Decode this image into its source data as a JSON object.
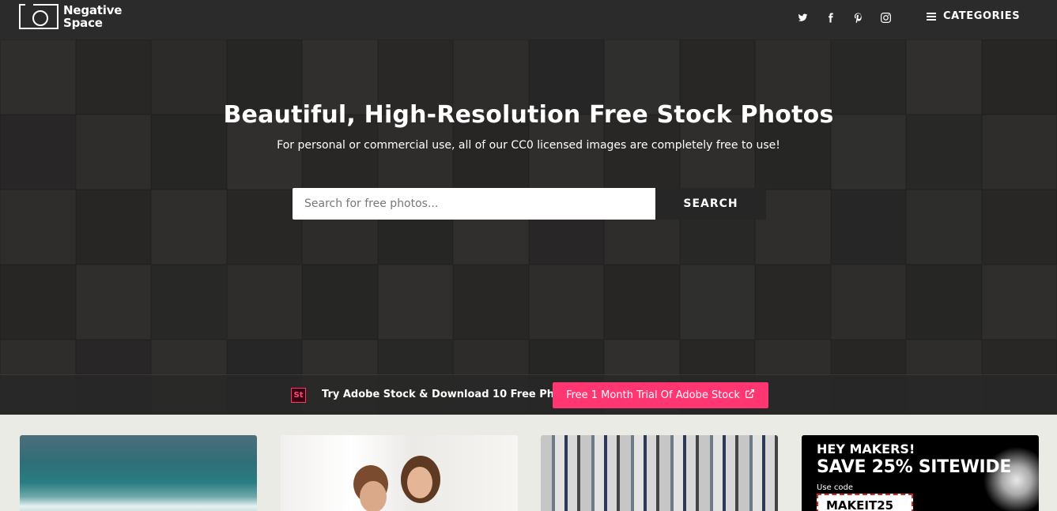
{
  "header": {
    "logo_line1": "Negative",
    "logo_line2": "Space",
    "social": [
      "twitter-icon",
      "facebook-icon",
      "pinterest-icon",
      "instagram-icon"
    ],
    "categories_label": "CATEGORIES"
  },
  "hero": {
    "title": "Beautiful, High-Resolution Free Stock Photos",
    "subtitle": "For personal or commercial use, all of our CC0 licensed images are completely free to use!",
    "search_placeholder": "Search for free photos...",
    "search_button": "SEARCH"
  },
  "promo": {
    "badge": "St",
    "text": "Try Adobe Stock & Download 10 Free Photos",
    "button": "Free 1 Month Trial Of Adobe Stock",
    "accent": "#ff3672"
  },
  "ad": {
    "line1": "HEY MAKERS!",
    "line2": "SAVE 25% SITEWIDE",
    "line3": "Use code",
    "code": "MAKEIT25"
  },
  "colors": {
    "header_bg": "#2b2b2b",
    "page_bg": "#ebebe6"
  }
}
